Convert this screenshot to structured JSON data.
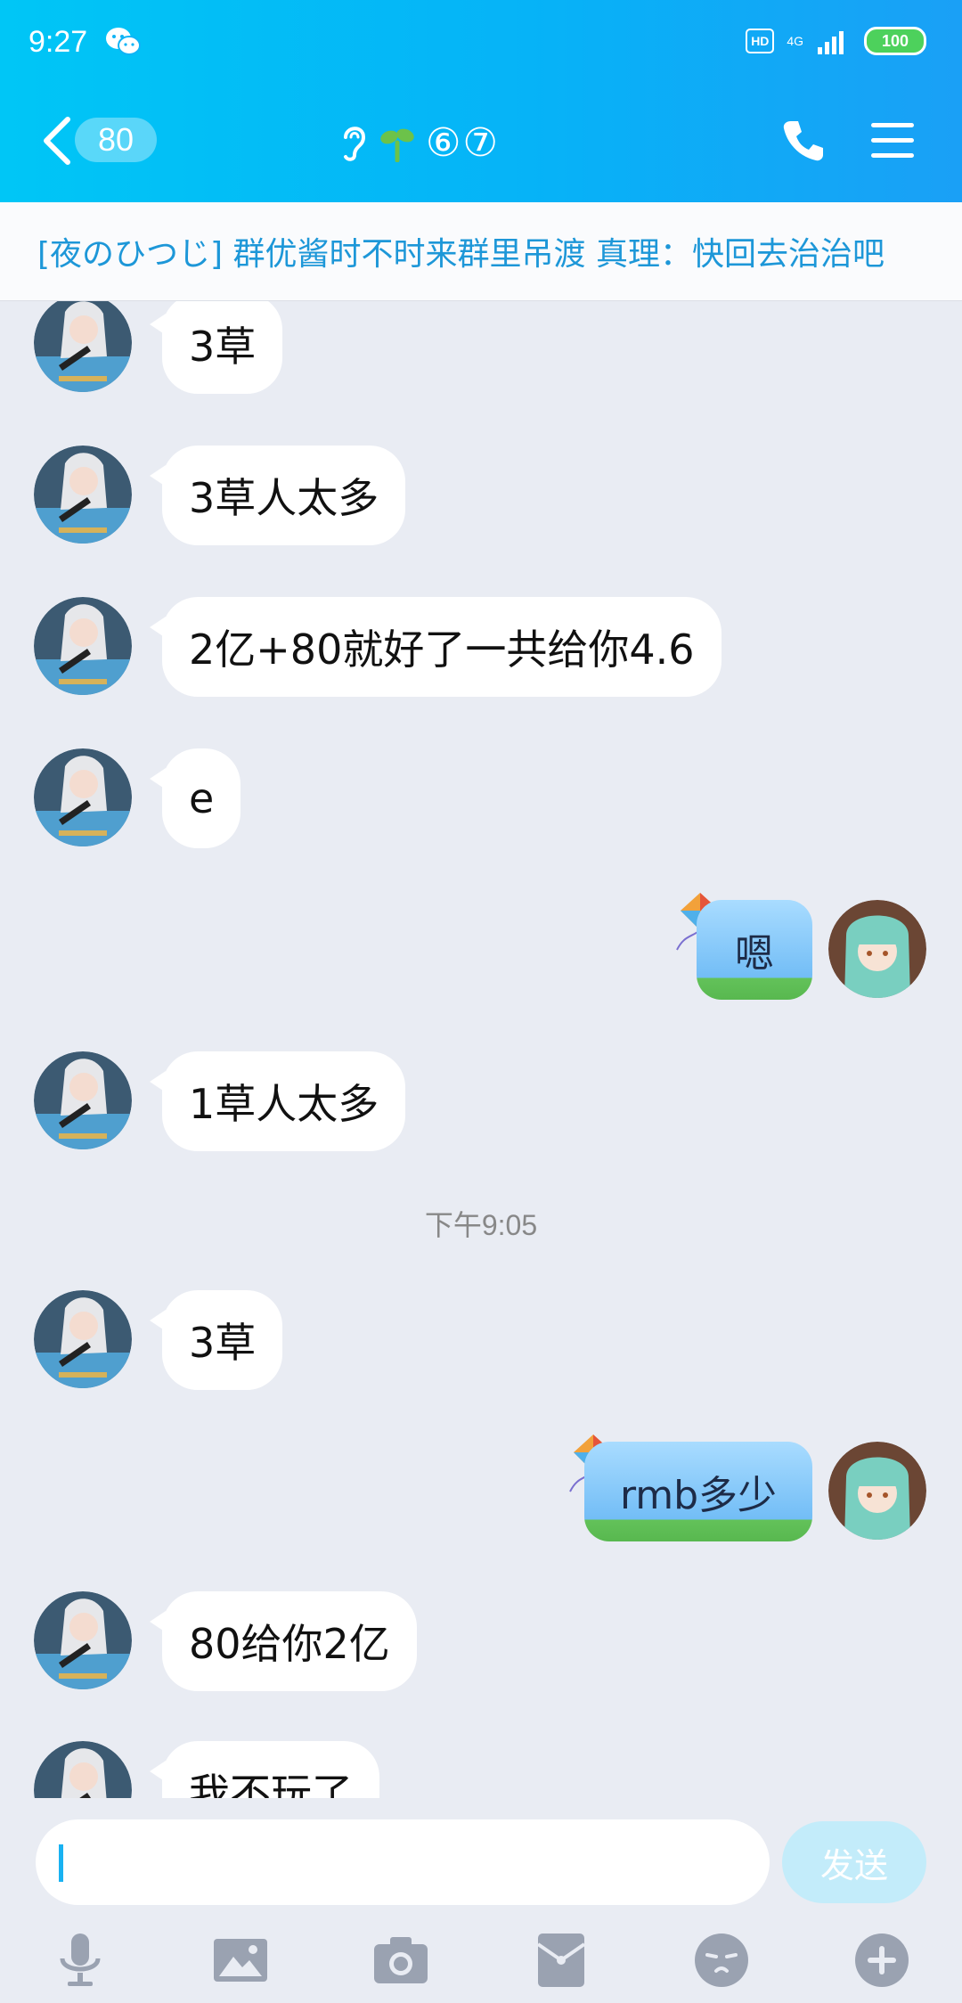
{
  "status_bar": {
    "time": "9:27",
    "hd": "HD",
    "network": "4G",
    "battery": "100"
  },
  "header": {
    "unread_count": "80",
    "title": "⑥⑦"
  },
  "announcement": "[夜のひつじ] 群优酱时不时来群里吊渡 真理：快回去治治吧",
  "messages": [
    {
      "side": "left",
      "text": "3草"
    },
    {
      "side": "left",
      "text": "3草人太多"
    },
    {
      "side": "left",
      "text": "2亿+80就好了一共给你4.6"
    },
    {
      "side": "left",
      "text": "e"
    },
    {
      "side": "right",
      "text": "嗯"
    },
    {
      "side": "left",
      "text": "1草人太多"
    },
    {
      "type": "time",
      "text": "下午9:05"
    },
    {
      "side": "left",
      "text": "3草"
    },
    {
      "side": "right",
      "text": "rmb多少"
    },
    {
      "side": "left",
      "text": "80给你2亿"
    },
    {
      "side": "left",
      "text": "我不玩了"
    }
  ],
  "input": {
    "value": "",
    "send_label": "发送"
  },
  "colors": {
    "header_start": "#00c6f6",
    "header_end": "#1aa0f6",
    "announce_text": "#1d97d8",
    "send_bg": "#c3ecfa"
  }
}
